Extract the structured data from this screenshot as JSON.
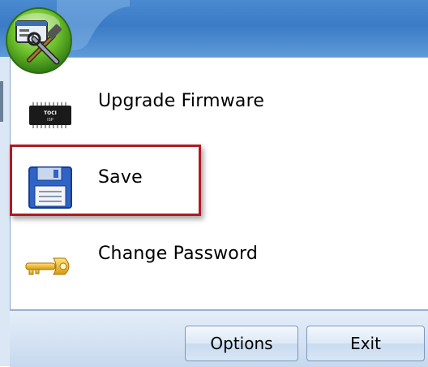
{
  "menu": {
    "items": [
      {
        "label": "Upgrade Firmware",
        "icon": "chip-icon"
      },
      {
        "label": "Save",
        "icon": "floppy-disk-icon"
      },
      {
        "label": "Change Password",
        "icon": "key-icon"
      }
    ]
  },
  "chip_text": [
    "TOCI",
    "ISP"
  ],
  "buttons": {
    "options": "Options",
    "exit": "Exit"
  },
  "colors": {
    "ribbon": "#3b7bc6",
    "highlight_border": "#b01a22",
    "button_border": "#7c98bb"
  }
}
